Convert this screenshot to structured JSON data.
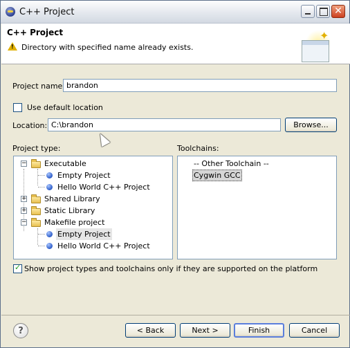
{
  "window": {
    "title": "C++ Project",
    "minimize_icon": "minimize-icon",
    "maximize_icon": "maximize-icon",
    "close_icon": "close-icon"
  },
  "banner": {
    "title": "C++ Project",
    "message": "Directory with specified name already exists.",
    "warning_icon": "warning-icon",
    "graphic_icon": "new-project-wizard-graphic"
  },
  "project_name": {
    "label": "Project name:",
    "value": "brandon"
  },
  "use_default_location": {
    "label": "Use default location",
    "checked": false
  },
  "location": {
    "label": "Location:",
    "value": "C:\\brandon",
    "browse_label": "Browse..."
  },
  "project_type": {
    "label": "Project type:",
    "tree": [
      {
        "label": "Executable",
        "expanded": true,
        "kind": "folder"
      },
      {
        "label": "Empty Project",
        "kind": "leaf"
      },
      {
        "label": "Hello World C++ Project",
        "kind": "leaf"
      },
      {
        "label": "Shared Library",
        "expanded": false,
        "kind": "folder"
      },
      {
        "label": "Static Library",
        "expanded": false,
        "kind": "folder"
      },
      {
        "label": "Makefile project",
        "expanded": true,
        "kind": "folder"
      },
      {
        "label": "Empty Project",
        "kind": "leaf",
        "selected": true
      },
      {
        "label": "Hello World C++ Project",
        "kind": "leaf"
      }
    ]
  },
  "toolchains": {
    "label": "Toolchains:",
    "items": [
      {
        "label": "-- Other Toolchain --"
      },
      {
        "label": "Cygwin GCC",
        "selected": true
      }
    ]
  },
  "show_supported": {
    "label": "Show project types and toolchains only if they are supported on the platform",
    "checked": true
  },
  "footer": {
    "help_icon": "help-icon",
    "help_glyph": "?",
    "back": "< Back",
    "next": "Next >",
    "finish": "Finish",
    "cancel": "Cancel"
  }
}
